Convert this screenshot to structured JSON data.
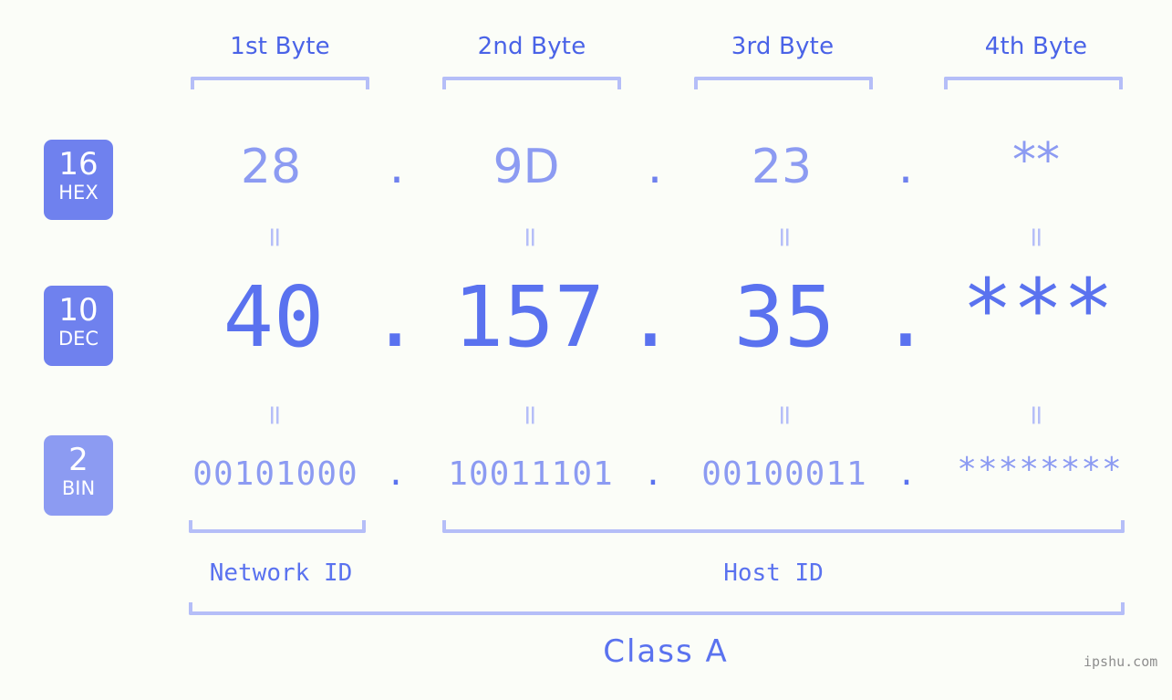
{
  "meta": {
    "background_color": "#fbfdf8",
    "accent_color": "#5a72ef",
    "light_accent_color": "#8c9bf2",
    "bracket_color": "#b5bef8",
    "badge_color": "#6f81ee",
    "badge_color_light": "#8c9bf2",
    "watermark": "ipshu.com"
  },
  "byte_headers": [
    {
      "label": "1st Byte"
    },
    {
      "label": "2nd Byte"
    },
    {
      "label": "3rd Byte"
    },
    {
      "label": "4th Byte"
    }
  ],
  "bases": [
    {
      "number": "16",
      "name": "HEX"
    },
    {
      "number": "10",
      "name": "DEC"
    },
    {
      "number": "2",
      "name": "BIN"
    }
  ],
  "rows": {
    "hex": {
      "base": "16",
      "base_name": "HEX",
      "values": [
        "28",
        "9D",
        "23",
        "**"
      ],
      "separator": "."
    },
    "dec": {
      "base": "10",
      "base_name": "DEC",
      "values": [
        "40",
        "157",
        "35",
        "***"
      ],
      "separator": "."
    },
    "bin": {
      "base": "2",
      "base_name": "BIN",
      "values": [
        "00101000",
        "10011101",
        "00100011",
        "********"
      ],
      "separator": "."
    }
  },
  "equals_marks": {
    "symbol": "=",
    "hex_to_dec_count": 4,
    "dec_to_bin_count": 4
  },
  "id_sections": [
    {
      "label": "Network ID",
      "spans_bytes": "1"
    },
    {
      "label": "Host ID",
      "spans_bytes": "2-4"
    }
  ],
  "class_section": {
    "label": "Class A",
    "spans_bytes": "1-4"
  }
}
